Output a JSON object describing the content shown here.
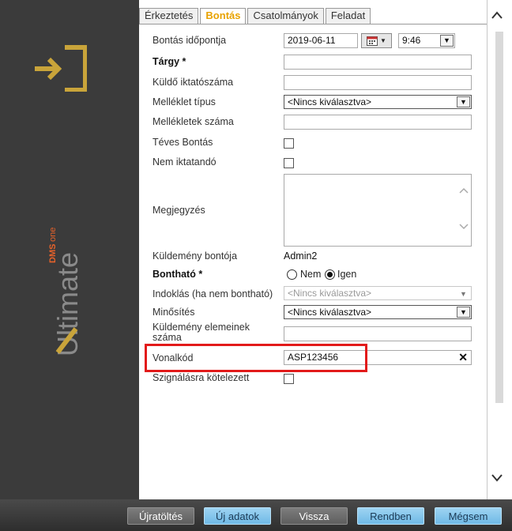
{
  "tabs": [
    {
      "label": "Érkeztetés",
      "active": false
    },
    {
      "label": "Bontás",
      "active": true
    },
    {
      "label": "Csatolmányok",
      "active": false
    },
    {
      "label": "Feladat",
      "active": false
    }
  ],
  "brand": {
    "prefix": "DMS",
    "one": "one",
    "name": "Ultimate"
  },
  "fields": {
    "bontas_idopontja": {
      "label": "Bontás időpontja",
      "date": "2019-06-11",
      "time": "9:46"
    },
    "targy": {
      "label": "Tárgy *",
      "value": ""
    },
    "kuldo_iktatoszama": {
      "label": "Küldő iktatószáma",
      "value": ""
    },
    "melleklet_tipus": {
      "label": "Melléklet típus",
      "value": "<Nincs kiválasztva>"
    },
    "mellekletek_szama": {
      "label": "Mellékletek száma",
      "value": ""
    },
    "teves_bontas": {
      "label": "Téves Bontás",
      "checked": false
    },
    "nem_iktatando": {
      "label": "Nem iktatandó",
      "checked": false
    },
    "megjegyzes": {
      "label": "Megjegyzés",
      "value": ""
    },
    "kuldemeny_bontoja": {
      "label": "Küldemény bontója",
      "value": "Admin2"
    },
    "bonthato": {
      "label": "Bontható *",
      "no_label": "Nem",
      "yes_label": "Igen",
      "selected": "Igen"
    },
    "indoklas": {
      "label": "Indoklás (ha nem bontható)",
      "value": "<Nincs kiválasztva>"
    },
    "minosites": {
      "label": "Minősítés",
      "value": "<Nincs kiválasztva>"
    },
    "elemek_szama": {
      "label": "Küldemény elemeinek száma",
      "value": ""
    },
    "vonalkod": {
      "label": "Vonalkód",
      "value": "ASP123456"
    },
    "szignalasra": {
      "label": "Szignálásra kötelezett",
      "checked": false
    }
  },
  "buttons": {
    "reload": "Újratöltés",
    "new_data": "Új adatok",
    "back": "Vissza",
    "ok": "Rendben",
    "cancel": "Mégsem"
  },
  "colors": {
    "active_tab": "#e8a200",
    "highlight": "#e21a1a",
    "brand_gold": "#c9a43a",
    "brand_orange": "#e8622a"
  }
}
